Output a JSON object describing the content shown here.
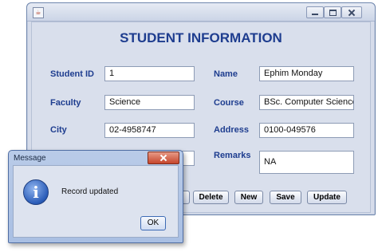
{
  "window": {
    "title": "",
    "icon": "java-icon",
    "heading": "STUDENT INFORMATION"
  },
  "form": {
    "student_id": {
      "label": "Student ID",
      "value": "1"
    },
    "name": {
      "label": "Name",
      "value": "Ephim Monday"
    },
    "faculty": {
      "label": "Faculty",
      "value": "Science"
    },
    "course": {
      "label": "Course",
      "value": "BSc. Computer Science"
    },
    "city": {
      "label": "City",
      "value": "02-4958747"
    },
    "address": {
      "label": "Address",
      "value": "0100-049576"
    },
    "remarks": {
      "label": "Remarks",
      "value": "NA"
    }
  },
  "buttons": {
    "delete": "Delete",
    "new": "New",
    "save": "Save",
    "update": "Update"
  },
  "dialog": {
    "title": "Message",
    "icon": "info-icon",
    "message": "Record updated",
    "ok": "OK"
  },
  "colors": {
    "label_blue": "#1e3d8f",
    "window_bg": "#d9dfec",
    "dialog_frame": "#a9bfe3"
  }
}
